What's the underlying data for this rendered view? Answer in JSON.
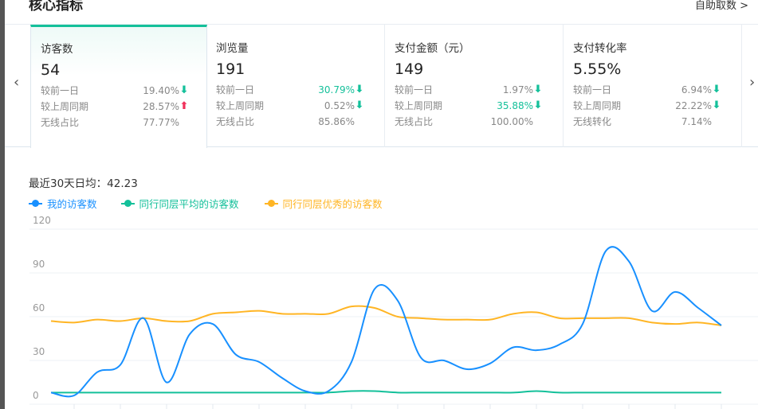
{
  "header": {
    "title": "核心指标",
    "self_help": "自助取数 >"
  },
  "nav": {
    "prev": "‹",
    "next": "›"
  },
  "cards": [
    {
      "label": "访客数",
      "value": "54",
      "rows": [
        {
          "label": "较前一日",
          "value": "19.40%",
          "trend": "down",
          "highlight": false
        },
        {
          "label": "较上周同期",
          "value": "28.57%",
          "trend": "up",
          "highlight": false
        },
        {
          "label": "无线占比",
          "value": "77.77%",
          "trend": null,
          "highlight": false
        }
      ]
    },
    {
      "label": "浏览量",
      "value": "191",
      "rows": [
        {
          "label": "较前一日",
          "value": "30.79%",
          "trend": "down",
          "highlight": true
        },
        {
          "label": "较上周同期",
          "value": "0.52%",
          "trend": "down",
          "highlight": false
        },
        {
          "label": "无线占比",
          "value": "85.86%",
          "trend": null,
          "highlight": false
        }
      ]
    },
    {
      "label": "支付金额（元）",
      "value": "149",
      "rows": [
        {
          "label": "较前一日",
          "value": "1.97%",
          "trend": "down",
          "highlight": false
        },
        {
          "label": "较上周同期",
          "value": "35.88%",
          "trend": "down",
          "highlight": true
        },
        {
          "label": "无线占比",
          "value": "100.00%",
          "trend": null,
          "highlight": false
        }
      ]
    },
    {
      "label": "支付转化率",
      "value": "5.55%",
      "rows": [
        {
          "label": "较前一日",
          "value": "6.94%",
          "trend": "down",
          "highlight": false
        },
        {
          "label": "较上周同期",
          "value": "22.22%",
          "trend": "down",
          "highlight": false
        },
        {
          "label": "无线转化",
          "value": "7.14%",
          "trend": null,
          "highlight": false
        }
      ]
    }
  ],
  "colors": {
    "accent": "#14c09a",
    "up": "#f0305a",
    "down": "#14c09a",
    "mine": "#1890ff",
    "avg": "#14c09a",
    "best": "#ffb524"
  },
  "summary": "最近30天日均：42.23",
  "chart_data": {
    "type": "line",
    "ylim": [
      0,
      120
    ],
    "yticks": [
      0,
      30,
      60,
      90,
      120
    ],
    "grid": true,
    "legend": "top-left",
    "series": [
      {
        "name": "我的访客数",
        "color": "#1890ff",
        "values": [
          8,
          6,
          22,
          27,
          59,
          15,
          48,
          55,
          34,
          29,
          18,
          9,
          9,
          29,
          79,
          71,
          32,
          30,
          24,
          28,
          39,
          37,
          41,
          55,
          105,
          98,
          64,
          77,
          66,
          54
        ]
      },
      {
        "name": "同行同层平均的访客数",
        "color": "#14c09a",
        "values": [
          8,
          8,
          8,
          8,
          8,
          8,
          8,
          8,
          8,
          8,
          8,
          8,
          8,
          9,
          9,
          8,
          8,
          8,
          8,
          8,
          8,
          9,
          8,
          8,
          8,
          8,
          8,
          8,
          8,
          8
        ]
      },
      {
        "name": "同行同层优秀的访客数",
        "color": "#ffb524",
        "values": [
          57,
          56,
          58,
          57,
          59,
          57,
          57,
          62,
          63,
          64,
          62,
          62,
          62,
          67,
          66,
          60,
          59,
          58,
          58,
          58,
          62,
          63,
          59,
          59,
          59,
          59,
          56,
          55,
          56,
          54
        ]
      }
    ]
  }
}
